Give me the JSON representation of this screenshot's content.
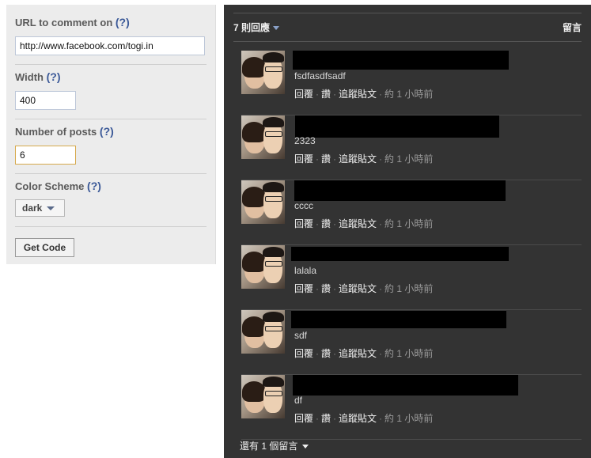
{
  "config": {
    "url_label": "URL to comment on",
    "url_value": "http://www.facebook.com/togi.in",
    "width_label": "Width",
    "width_value": "400",
    "posts_label": "Number of posts",
    "posts_value": "6",
    "scheme_label": "Color Scheme",
    "scheme_value": "dark",
    "help": "(?)",
    "get_code": "Get Code"
  },
  "plugin": {
    "count_label": "7 則回應",
    "post_label": "留言",
    "reply": "回覆",
    "like": "讚",
    "follow": "追蹤貼文",
    "time": "約 1 小時前",
    "more_label": "還有 1 個留言",
    "comments": [
      {
        "text": "fsdfasdfsadf"
      },
      {
        "text": "2323"
      },
      {
        "text": "cccc"
      },
      {
        "text": "lalala"
      },
      {
        "text": "sdf"
      },
      {
        "text": "df"
      }
    ]
  },
  "colors": {
    "plugin_bg": "#333333",
    "link_blue": "#3b5998",
    "panel_bg": "#ececec"
  }
}
